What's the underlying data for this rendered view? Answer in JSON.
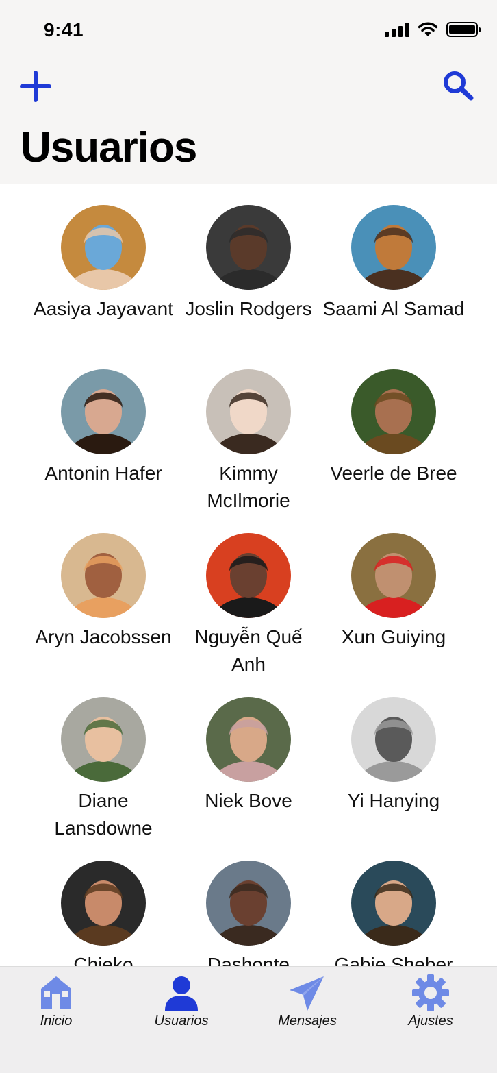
{
  "status_bar": {
    "time": "9:41"
  },
  "header": {
    "title": "Usuarios",
    "add_icon": "plus-icon",
    "search_icon": "search-icon"
  },
  "colors": {
    "accent": "#1f3ad6",
    "tab_inactive": "#6e8ae6",
    "header_bg": "#f6f5f4",
    "tabbar_bg": "#efeeef"
  },
  "users": [
    {
      "name": "Aasiya Jayavant",
      "avatar_colors": [
        "#c58a3e",
        "#6aa8d8",
        "#e8c7a8"
      ]
    },
    {
      "name": "Joslin Rodgers",
      "avatar_colors": [
        "#3a3a3a",
        "#5a3a2a",
        "#2b2b2b"
      ]
    },
    {
      "name": "Saami Al Samad",
      "avatar_colors": [
        "#4a90b8",
        "#c07a3a",
        "#4a3020"
      ]
    },
    {
      "name": "Antonin Hafer",
      "avatar_colors": [
        "#7a9aa8",
        "#d8a890",
        "#2a1a10"
      ]
    },
    {
      "name": "Kimmy McIlmorie",
      "avatar_colors": [
        "#c8c0b8",
        "#f0d8c8",
        "#3a2a20"
      ]
    },
    {
      "name": "Veerle de Bree",
      "avatar_colors": [
        "#3a5a2a",
        "#a87050",
        "#6a4a20"
      ]
    },
    {
      "name": "Aryn Jacobssen",
      "avatar_colors": [
        "#d8b890",
        "#a06040",
        "#e8a060"
      ]
    },
    {
      "name": "Nguyễn Quế Anh",
      "avatar_colors": [
        "#d84020",
        "#6a4030",
        "#1a1a1a"
      ]
    },
    {
      "name": "Xun Guiying",
      "avatar_colors": [
        "#8a7040",
        "#c09070",
        "#d82020"
      ]
    },
    {
      "name": "Diane Lansdowne",
      "avatar_colors": [
        "#a8a8a0",
        "#e8c0a0",
        "#4a6a3a"
      ]
    },
    {
      "name": "Niek Bove",
      "avatar_colors": [
        "#5a6a4a",
        "#d8a888",
        "#c8a0a0"
      ]
    },
    {
      "name": "Yi Hanying",
      "avatar_colors": [
        "#d8d8d8",
        "#5a5a5a",
        "#9a9a9a"
      ]
    },
    {
      "name": "Chieko",
      "avatar_colors": [
        "#2a2a2a",
        "#c88a6a",
        "#5a3a20"
      ]
    },
    {
      "name": "Dashonte",
      "avatar_colors": [
        "#6a7a8a",
        "#6a4030",
        "#3a2a20"
      ]
    },
    {
      "name": "Gabie Sheber",
      "avatar_colors": [
        "#2a4a5a",
        "#d8a888",
        "#3a2a1a"
      ]
    }
  ],
  "tabbar": {
    "tabs": [
      {
        "label": "Inicio",
        "icon": "house-icon",
        "active": false
      },
      {
        "label": "Usuarios",
        "icon": "user-icon",
        "active": true
      },
      {
        "label": "Mensajes",
        "icon": "paper-plane-icon",
        "active": false
      },
      {
        "label": "Ajustes",
        "icon": "gear-icon",
        "active": false
      }
    ]
  }
}
